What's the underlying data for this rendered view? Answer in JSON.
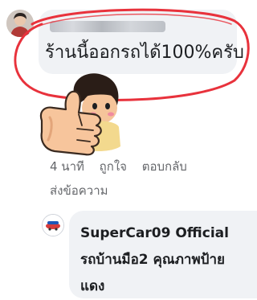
{
  "comment": {
    "author_name": "",
    "text": "ร้านนี้ออกรถได้100%ครับ",
    "highlight_color": "#e8323c",
    "sticker": "thumbs-up-girl-sticker"
  },
  "actions": {
    "time": "4 นาที",
    "like": "ถูกใจ",
    "reply": "ตอบกลับ",
    "message": "ส่งข้อความ"
  },
  "reply": {
    "author_name": "SuperCar09 Official รถบ้านมือ2 คุณภาพป้ายแดง"
  }
}
